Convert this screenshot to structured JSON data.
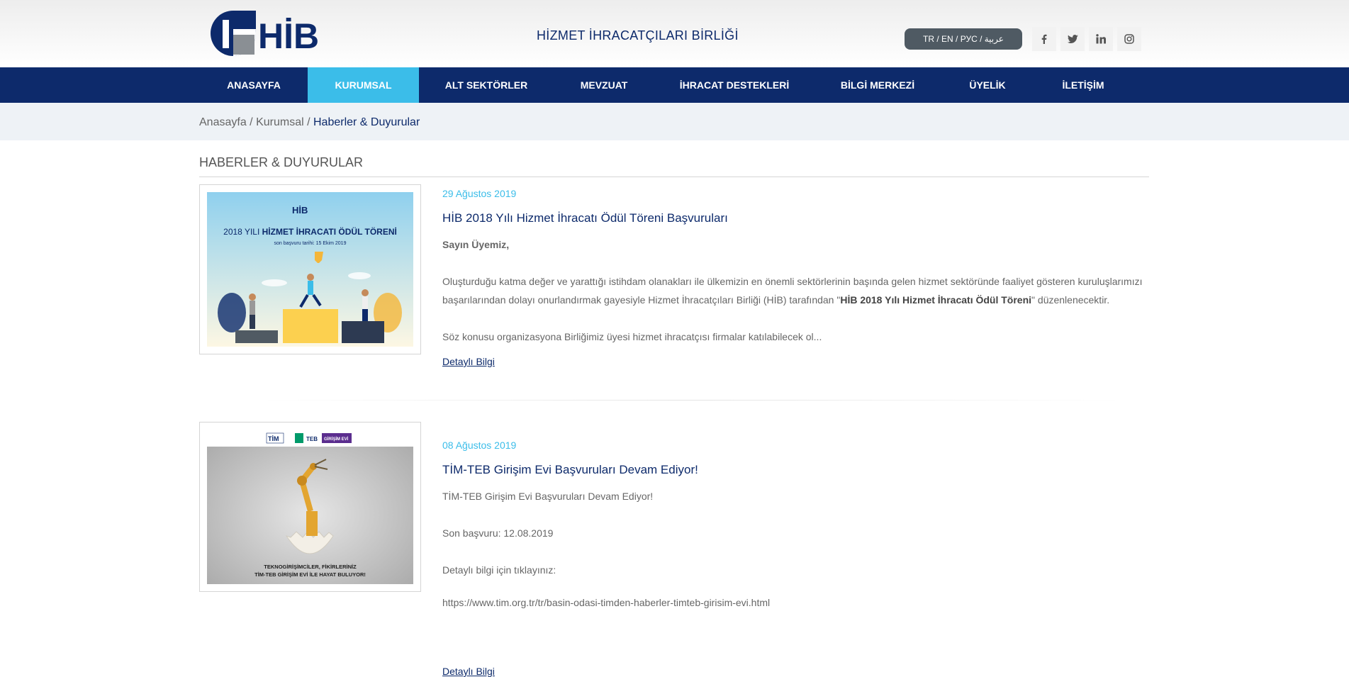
{
  "header": {
    "site_title": "HİZMET İHRACATÇILARI BİRLİĞİ",
    "language_switch": "TR / EN / РУС / عربية",
    "socials": [
      "facebook-icon",
      "twitter-icon",
      "linkedin-icon",
      "instagram-icon"
    ],
    "colors": {
      "brand": "#0d2a6b",
      "accent": "#3bbde9"
    }
  },
  "nav": {
    "items": [
      {
        "label": "ANASAYFA"
      },
      {
        "label": "KURUMSAL"
      },
      {
        "label": "ALT SEKTÖRLER"
      },
      {
        "label": "MEVZUAT"
      },
      {
        "label": "İHRACAT DESTEKLERİ"
      },
      {
        "label": "BİLGİ MERKEZİ"
      },
      {
        "label": "ÜYELİK"
      },
      {
        "label": "İLETİŞİM"
      }
    ],
    "active": "KURUMSAL"
  },
  "breadcrumb": {
    "home": "Anasayfa",
    "sep": " / ",
    "section": "Kurumsal",
    "current": "Haberler & Duyurular"
  },
  "page": {
    "title": "HABERLER & DUYURULAR"
  },
  "articles": [
    {
      "date": "29 Ağustos 2019",
      "title": "HİB 2018 Yılı Hizmet İhracatı Ödül Töreni Başvuruları",
      "greeting": "Sayın Üyemiz,",
      "body_start": "Oluşturduğu katma değer ve yarattığı istihdam olanakları ile ülkemizin en önemli sektörlerinin başında gelen hizmet sektöründe faaliyet gösteren kuruluşlarımızı başarılarından dolayı onurlandırmak gayesiyle Hizmet İhracatçıları Birliği (HİB) tarafından \"",
      "body_bold": "HİB 2018 Yılı Hizmet İhracatı Ödül Töreni",
      "body_end": "\" düzenlenecektir.",
      "excerpt": "Söz konusu organizasyona Birliğimiz üyesi hizmet ihracatçısı firmalar katılabilecek ol...",
      "more": "Detaylı Bilgi",
      "image": {
        "heading": "2018 YILI HİZMET İHRACATI ÖDÜL TÖRENİ",
        "heading_light": "2018 YILI ",
        "heading_bold": "HİZMET İHRACATI ÖDÜL TÖRENİ",
        "subline": "son başvuru tarihi: 15 Ekim 2019",
        "logo": "HİB"
      }
    },
    {
      "date": "08 Ağustos 2019",
      "title": "TİM-TEB Girişim Evi Başvuruları Devam Ediyor!",
      "lines": [
        "TİM-TEB Girişim Evi Başvuruları Devam Ediyor!",
        "Son başvuru: 12.08.2019",
        "Detaylı bilgi için tıklayınız:",
        "https://www.tim.org.tr/tr/basin-odasi-timden-haberler-timteb-girisim-evi.html"
      ],
      "more": "Detaylı Bilgi",
      "image": {
        "logos": [
          "TİM",
          "TEB",
          "GİRİŞİM EVİ"
        ],
        "caption_1": "TEKNOGİRİŞİMCİLER, FİKİRLERİNİZ",
        "caption_2": "TİM-TEB GİRİŞİM EVİ İLE HAYAT BULUYOR!"
      }
    }
  ]
}
